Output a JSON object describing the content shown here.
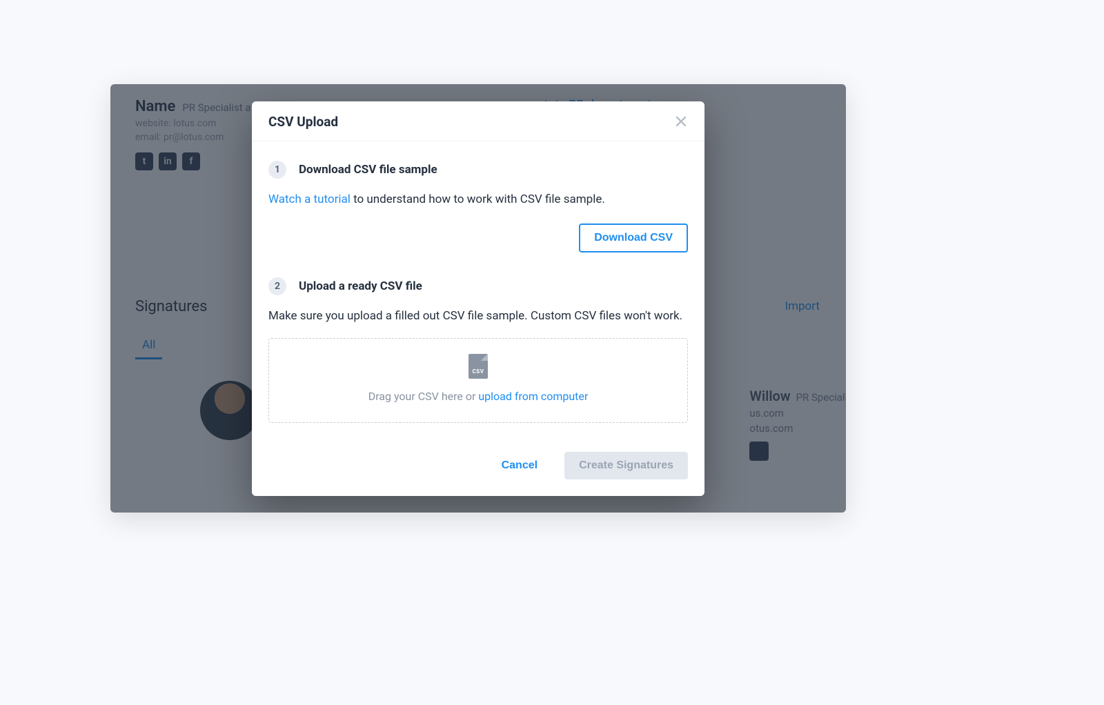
{
  "background": {
    "name": "Name",
    "role": "PR Specialist at Lotus Ltd.",
    "website_label": "website:",
    "website": "lotus.com",
    "email_label": "email:",
    "email": "pr@lotus.com",
    "department": "PR department",
    "section_title": "Signatures",
    "import": "Import",
    "tab_all": "All",
    "card2_name": "Willow",
    "card2_role": "PR Specialis",
    "card2_line1": "us.com",
    "card2_line2": "otus.com"
  },
  "modal": {
    "title": "CSV Upload",
    "step1_num": "1",
    "step1_title": "Download CSV file sample",
    "step1_link": "Watch a tutorial",
    "step1_rest": " to understand how to work with CSV file sample.",
    "download_btn": "Download CSV",
    "step2_num": "2",
    "step2_title": "Upload a ready CSV file",
    "step2_desc": "Make sure you upload a filled out CSV file sample. Custom CSV files won't work.",
    "drop_text": "Drag your CSV here or ",
    "drop_link": "upload from computer",
    "file_tag": "CSV",
    "cancel": "Cancel",
    "create": "Create Signatures"
  }
}
